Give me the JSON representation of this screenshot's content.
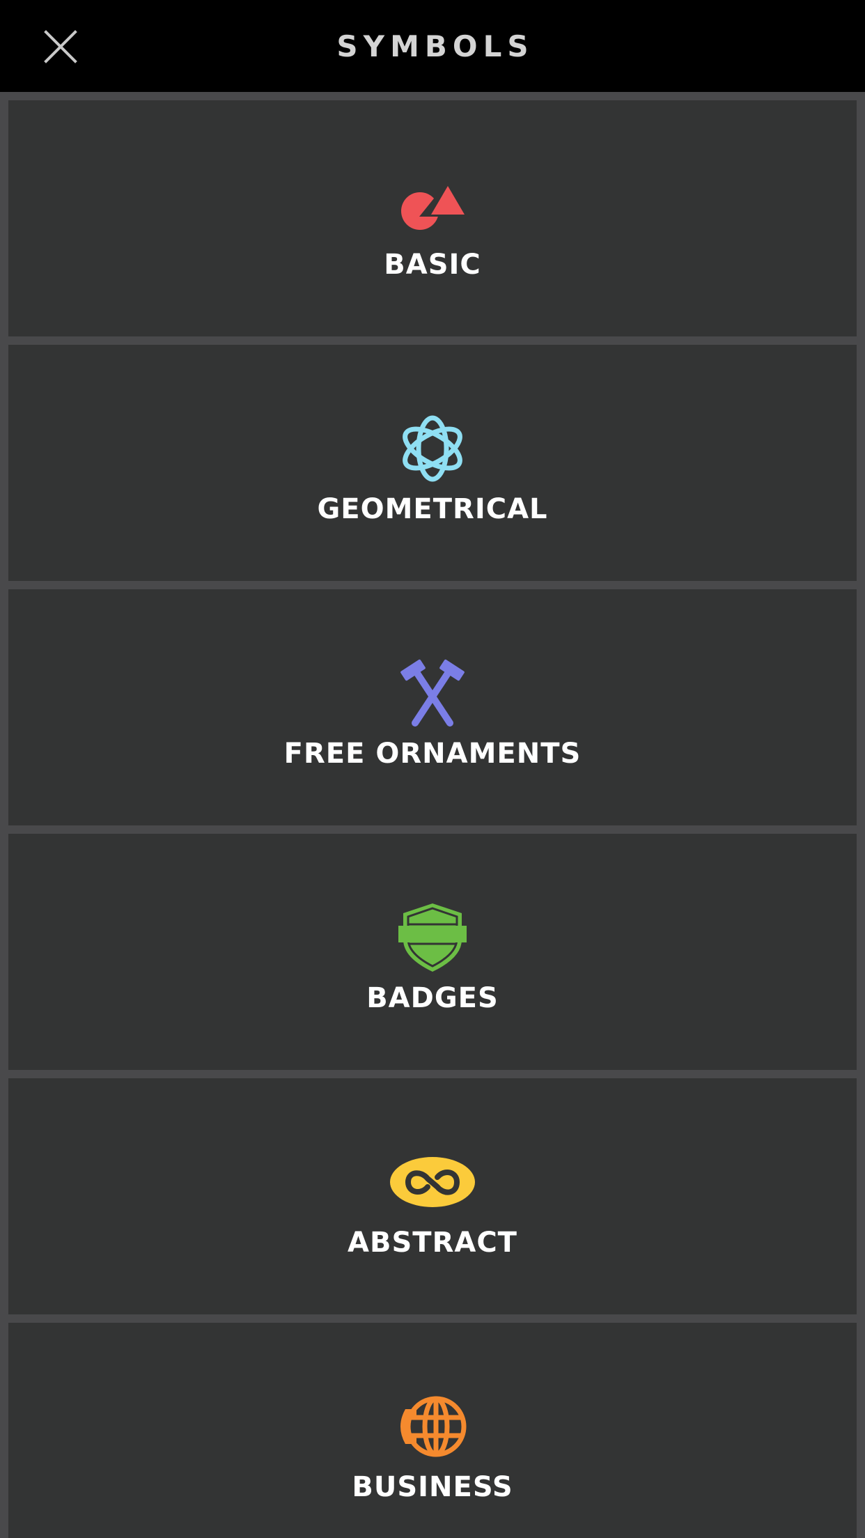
{
  "header": {
    "title": "SYMBOLS",
    "close_icon": "close-icon"
  },
  "categories": [
    {
      "label": "BASIC",
      "icon": "shapes-icon",
      "color": "#ef5356"
    },
    {
      "label": "GEOMETRICAL",
      "icon": "geometric-flower-icon",
      "color": "#8fdff3"
    },
    {
      "label": "FREE ORNAMENTS",
      "icon": "crossed-hammers-icon",
      "color": "#7b7ee6"
    },
    {
      "label": "BADGES",
      "icon": "shield-badge-icon",
      "color": "#6cbe45"
    },
    {
      "label": "ABSTRACT",
      "icon": "infinity-icon",
      "color": "#fbcb3b"
    },
    {
      "label": "BUSINESS",
      "icon": "globe-phone-icon",
      "color": "#f58a2e"
    }
  ],
  "colors": {
    "header_bg": "#000000",
    "header_text": "#d4d4d4",
    "card_bg": "#333434",
    "gap": "#49494b",
    "label": "#ffffff"
  }
}
